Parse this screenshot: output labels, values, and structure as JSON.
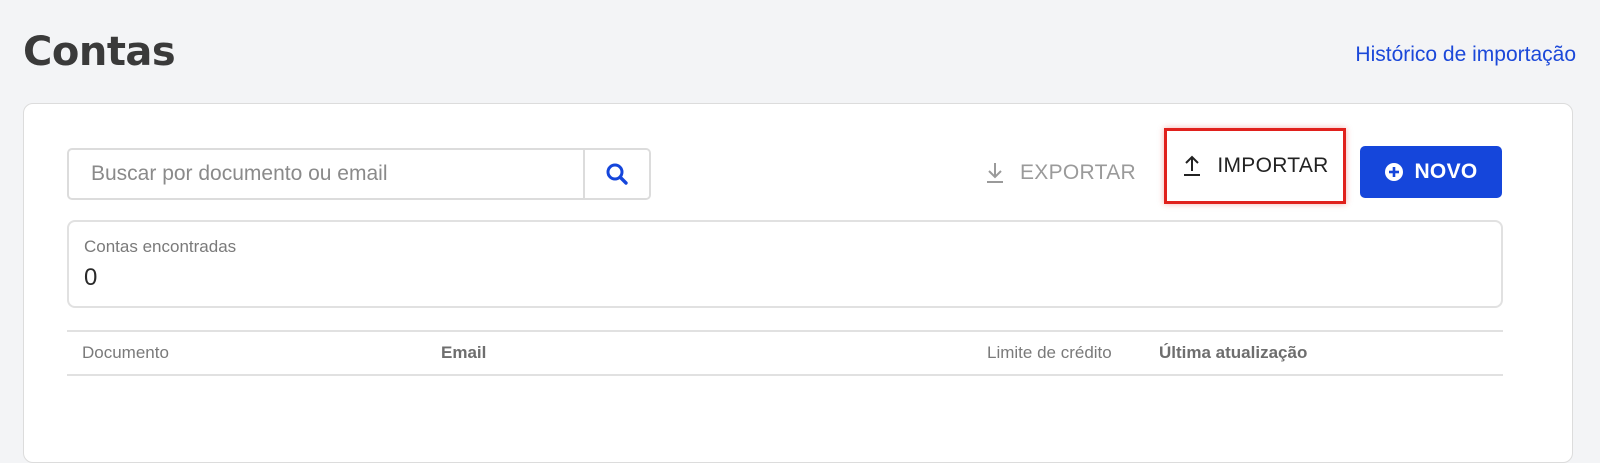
{
  "header": {
    "title": "Contas",
    "history_link": "Histórico de importação"
  },
  "toolbar": {
    "search_placeholder": "Buscar por documento ou email",
    "search_value": "",
    "export_label": "EXPORTAR",
    "import_label": "IMPORTAR",
    "new_label": "NOVO"
  },
  "summary": {
    "label": "Contas encontradas",
    "count": "0"
  },
  "table": {
    "columns": [
      "Documento",
      "Email",
      "Limite de crédito",
      "Última atualização"
    ],
    "rows": []
  },
  "colors": {
    "accent": "#1546db",
    "link": "#1b48d9",
    "highlight": "#e0201c"
  },
  "icons": {
    "search": "search-icon",
    "export": "download-icon",
    "import": "upload-icon",
    "new": "plus-circle-icon"
  }
}
